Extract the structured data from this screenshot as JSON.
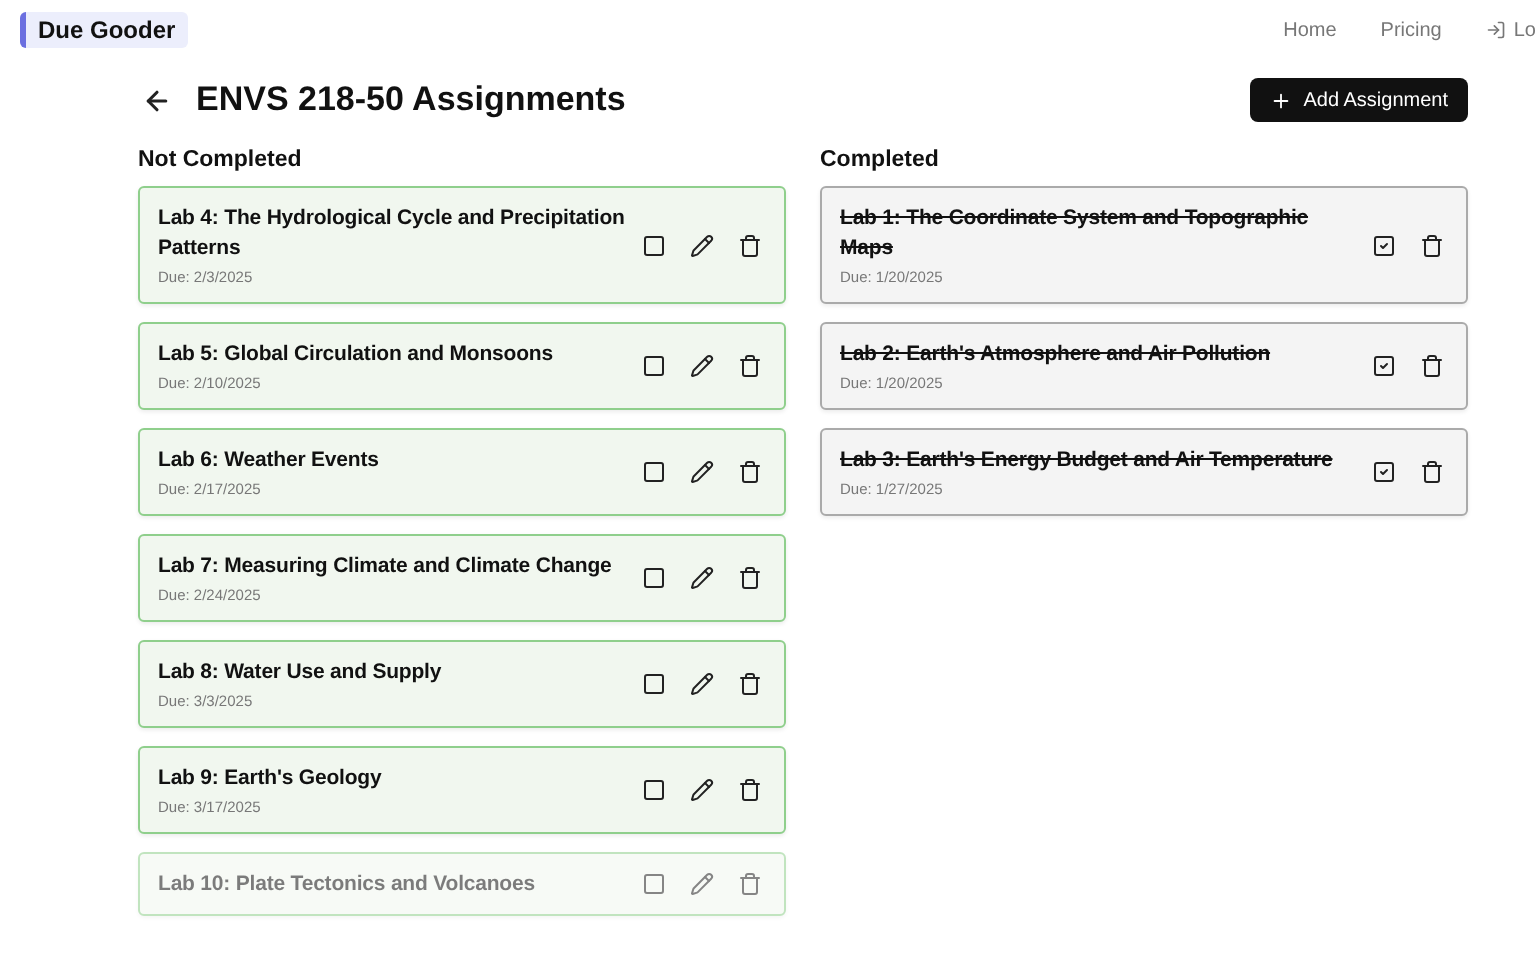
{
  "brand": "Due Gooder",
  "nav": [
    {
      "label": "Home"
    },
    {
      "label": "Pricing"
    },
    {
      "label": "Lo",
      "kind": "logout"
    }
  ],
  "title": "ENVS 218-50 Assignments",
  "add_button": "Add Assignment",
  "columns": [
    {
      "heading": "Not Completed",
      "items": [
        {
          "title": "Lab 4: The Hydrological Cycle and Precipitation Patterns",
          "due": "Due: 2/3/2025",
          "checked": false,
          "faded": false
        },
        {
          "title": "Lab 5: Global Circulation and Monsoons",
          "due": "Due: 2/10/2025",
          "checked": false,
          "faded": false
        },
        {
          "title": "Lab 6: Weather Events",
          "due": "Due: 2/17/2025",
          "checked": false,
          "faded": false
        },
        {
          "title": "Lab 7: Measuring Climate and Climate Change",
          "due": "Due: 2/24/2025",
          "checked": false,
          "faded": false
        },
        {
          "title": "Lab 8: Water Use and Supply",
          "due": "Due: 3/3/2025",
          "checked": false,
          "faded": false
        },
        {
          "title": "Lab 9: Earth's Geology",
          "due": "Due: 3/17/2025",
          "checked": false,
          "faded": false
        },
        {
          "title": "Lab 10: Plate Tectonics and Volcanoes",
          "checked": false,
          "faded": true
        }
      ]
    },
    {
      "heading": "Completed",
      "items": [
        {
          "title": "Lab 1: The Coordinate System and Topographic Maps",
          "due": "Due: 1/20/2025",
          "checked": true,
          "faded": false
        },
        {
          "title": "Lab 2: Earth's Atmosphere and Air Pollution",
          "due": "Due: 1/20/2025",
          "checked": true,
          "faded": false
        },
        {
          "title": "Lab 3: Earth's Energy Budget and Air Temperature",
          "due": "Due: 1/27/2025",
          "checked": true,
          "faded": false
        }
      ]
    }
  ]
}
